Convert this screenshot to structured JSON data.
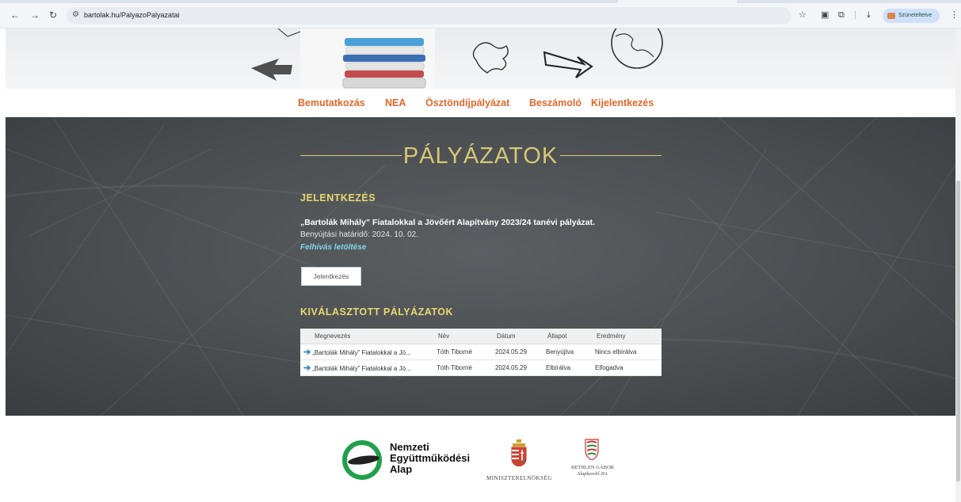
{
  "browser": {
    "url": "bartolak.hu/PalyazoPalyazatai",
    "profile_label": "Szüneteltetve"
  },
  "menu": {
    "items": [
      "Bemutatkozás",
      "NEA",
      "Ösztöndíjpályázat",
      "Beszámoló",
      "Kijelentkezés"
    ]
  },
  "main": {
    "heading": "PÁLYÁZATOK",
    "application_section": {
      "title": "JELENTKEZÉS",
      "call_title": "„Bartolák Mihály” Fiatalokkal a Jövőért Alapítvány 2023/24 tanévi pályázat.",
      "deadline": "Benyújtási határidő: 2024. 10. 02.",
      "download_link": "Felhívás letöltése",
      "apply_button": "Jelentkezés"
    },
    "selected_section": {
      "title": "KIVÁLASZTOTT PÁLYÁZATOK",
      "columns": [
        "Megnevezés",
        "Név",
        "Dátum",
        "Állapot",
        "Eredmény"
      ],
      "rows": [
        [
          "„Bartolák Mihály” Fiatalokkal a Jö...",
          "Tóth Tiborné",
          "2024.05.29",
          "Benyújtva",
          "Nincs elbírálva"
        ],
        [
          "„Bartolák Mihály” Fiatalokkal a Jö...",
          "Tóth Tiborné",
          "2024.05.29",
          "Elbírálva",
          "Elfogadva"
        ]
      ]
    }
  },
  "footer": {
    "nea_lines": [
      "Nemzeti",
      "Együttműködési",
      "Alap"
    ],
    "ministry": "MINISZTERELNÖKSÉG",
    "bethlen_lines": [
      "BETHLEN GÁBOR",
      "Alapkezelő Zrt."
    ]
  },
  "colors": {
    "menu_accent": "#e2672a",
    "heading_gold": "#d6c873",
    "link_cyan": "#7fd7ee",
    "nea_green": "#21a04b"
  }
}
